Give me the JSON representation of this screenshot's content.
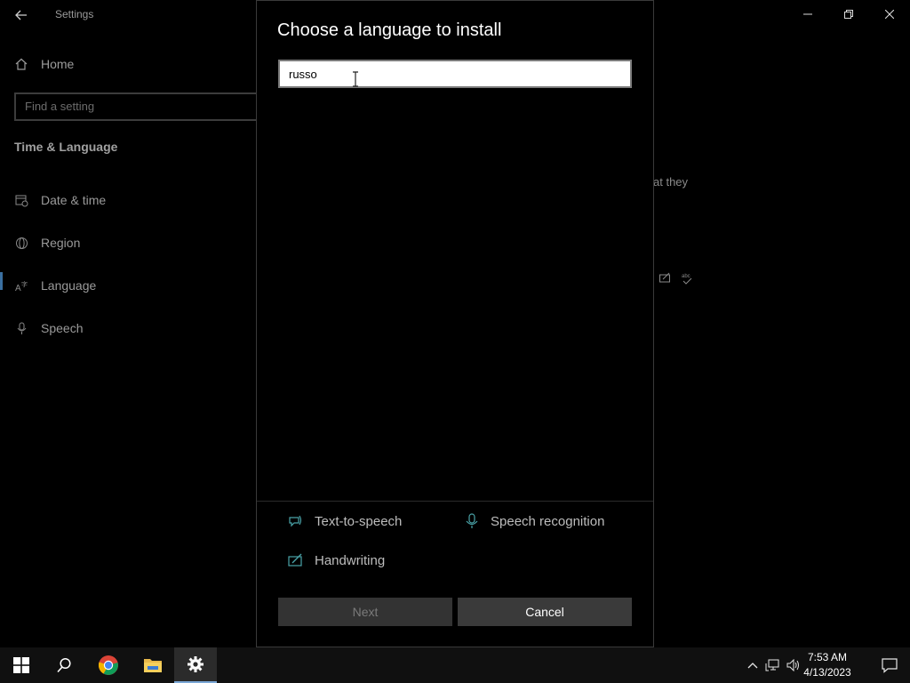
{
  "settings": {
    "window_title": "Settings",
    "back_icon": "back-arrow-icon",
    "controls": {
      "minimize_icon": "minimize-icon",
      "maximize_icon": "restore-icon",
      "close_icon": "close-icon"
    },
    "sidebar": {
      "home_label": "Home",
      "search_placeholder": "Find a setting",
      "section_title": "Time & Language",
      "items": [
        {
          "label": "Date & time",
          "icon": "calendar-clock-icon"
        },
        {
          "label": "Region",
          "icon": "globe-icon"
        },
        {
          "label": "Language",
          "icon": "language-icon"
        },
        {
          "label": "Speech",
          "icon": "microphone-icon"
        }
      ]
    },
    "background_text": "at they"
  },
  "dialog": {
    "title": "Choose a language to install",
    "search_value": "russo",
    "features": [
      {
        "label": "Text-to-speech",
        "icon": "text-to-speech-icon"
      },
      {
        "label": "Speech recognition",
        "icon": "microphone-icon"
      },
      {
        "label": "Handwriting",
        "icon": "handwriting-icon"
      }
    ],
    "next_label": "Next",
    "cancel_label": "Cancel"
  },
  "taskbar": {
    "items": [
      {
        "name": "start",
        "icon": "windows-logo-icon"
      },
      {
        "name": "search",
        "icon": "search-icon"
      },
      {
        "name": "chrome",
        "icon": "chrome-icon"
      },
      {
        "name": "file-explorer",
        "icon": "folder-icon"
      },
      {
        "name": "settings",
        "icon": "gear-icon",
        "active": true
      }
    ],
    "time": "7:53 AM",
    "date": "4/13/2023"
  },
  "colors": {
    "accent": "#7aa7d6",
    "feature_icon": "#4aa3a8",
    "background": "#000000"
  }
}
